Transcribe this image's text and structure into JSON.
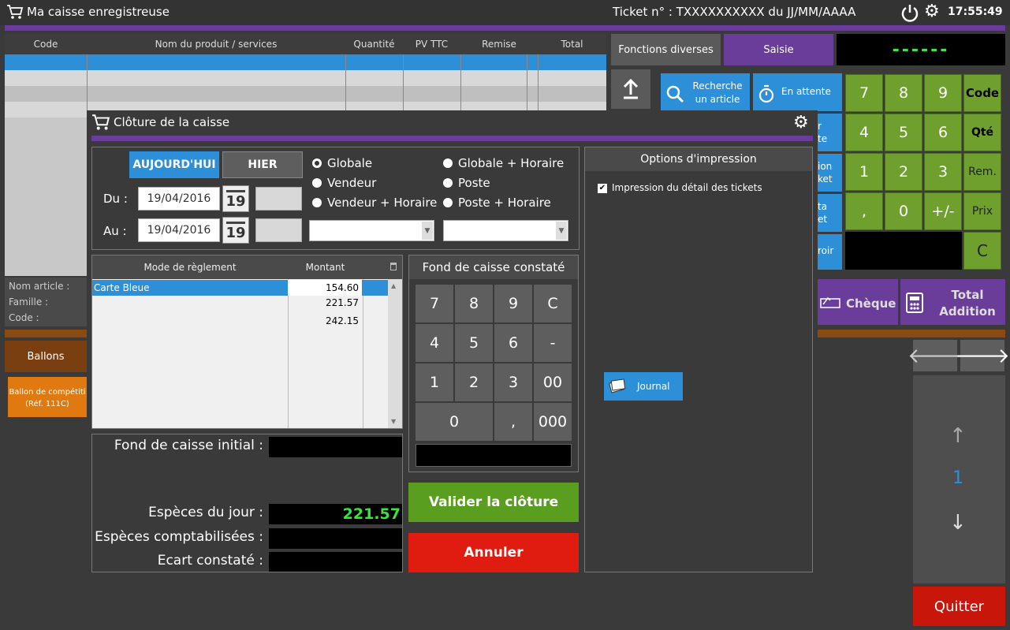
{
  "app": {
    "title": "Ma caisse enregistreuse",
    "ticket": "Ticket n° : TXXXXXXXXXX du JJ/MM/AAAA",
    "time": "17:55:49"
  },
  "table": {
    "headers": [
      "Code",
      "Nom du produit / services",
      "Quantité",
      "PV TTC",
      "Remise",
      "Total"
    ]
  },
  "info": {
    "nom": "Nom article :",
    "famille": "Famille :",
    "code": "Code :"
  },
  "category": {
    "label": "Ballons"
  },
  "product": {
    "line1": "Ballon de compétiti",
    "line2": "(Réf. 111C)"
  },
  "right": {
    "tabs": [
      "Fonctions diverses",
      "Saisie"
    ],
    "display": "------",
    "search": [
      "Recherche",
      "un article"
    ],
    "pending": "En attente",
    "side_partial": [
      "r",
      "te",
      "ion",
      "ket",
      "ta",
      "et",
      "roir"
    ],
    "keys": [
      "7",
      "8",
      "9",
      "Code",
      "4",
      "5",
      "6",
      "Qté",
      "1",
      "2",
      "3",
      "Rem.",
      ",",
      "0",
      "+/-",
      "Prix",
      "C"
    ],
    "cheque": "Chèque",
    "total": [
      "Total",
      "Addition"
    ],
    "page": "1",
    "quit": "Quitter"
  },
  "modal": {
    "title": "Clôture de la caisse",
    "btn_today": "AUJOURD'HUI",
    "btn_yesterday": "HIER",
    "du_label": "Du :",
    "au_label": "Au :",
    "du_date": "19/04/2016",
    "au_date": "19/04/2016",
    "cal": "19",
    "radios": {
      "globale": "Globale",
      "vendeur": "Vendeur",
      "vendeur_horaire": "Vendeur + Horaire",
      "globale_horaire": "Globale + Horaire",
      "poste": "Poste",
      "poste_horaire": "Poste + Horaire"
    },
    "payment": {
      "headers": [
        "Mode de règlement",
        "Montant"
      ],
      "rows": [
        {
          "mode": "Carte Bleue",
          "montant": "154.60"
        },
        {
          "mode": "",
          "montant": "221.57"
        },
        {
          "mode": "",
          "montant": "242.15"
        }
      ]
    },
    "fond_title": "Fond de caisse constaté",
    "keypad": [
      "7",
      "8",
      "9",
      "C",
      "4",
      "5",
      "6",
      "-",
      "1",
      "2",
      "3",
      "00",
      "0",
      ",",
      "000"
    ],
    "fond_initial": "Fond de caisse initial :",
    "especes_jour": "Espèces du jour :",
    "especes_jour_value": "221.57",
    "especes_compta": "Espèces comptabilisées :",
    "ecart": "Ecart constaté :",
    "valider": "Valider la clôture",
    "annuler": "Annuler",
    "options_title": "Options d'impression",
    "print_detail": "Impression du détail des tickets",
    "journal": "Journal"
  },
  "colors": {
    "purple": "#6a3d9a",
    "green": "#6fa02e",
    "blue": "#2d8fd8",
    "red": "#e01b0f",
    "orange": "#e07a10"
  }
}
